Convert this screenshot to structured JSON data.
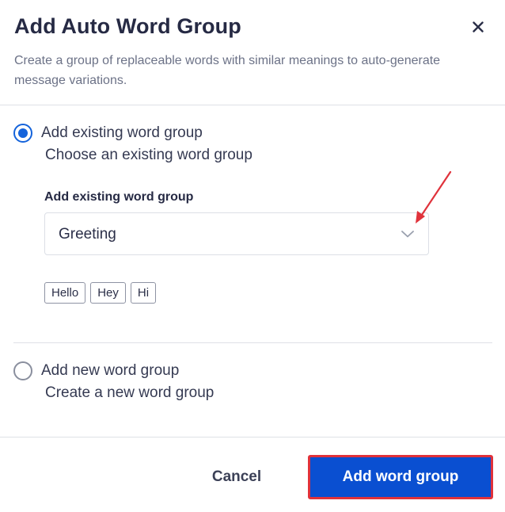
{
  "dialog": {
    "title": "Add Auto Word Group",
    "subtitle": "Create a group of replaceable words with similar meanings to auto-generate message variations.",
    "close_icon": "close-icon"
  },
  "options": {
    "existing": {
      "label": "Add existing word group",
      "description": "Choose an existing word group",
      "selected": true
    },
    "new": {
      "label": "Add new word group",
      "description": "Create a new word group",
      "selected": false
    }
  },
  "existing_group": {
    "field_label": "Add existing word group",
    "selected_value": "Greeting",
    "words": [
      "Hello",
      "Hey",
      "Hi"
    ]
  },
  "footer": {
    "cancel_label": "Cancel",
    "submit_label": "Add word group"
  },
  "colors": {
    "accent": "#1463db",
    "primary_button": "#0a4fd1",
    "annotation": "#e0323b"
  }
}
